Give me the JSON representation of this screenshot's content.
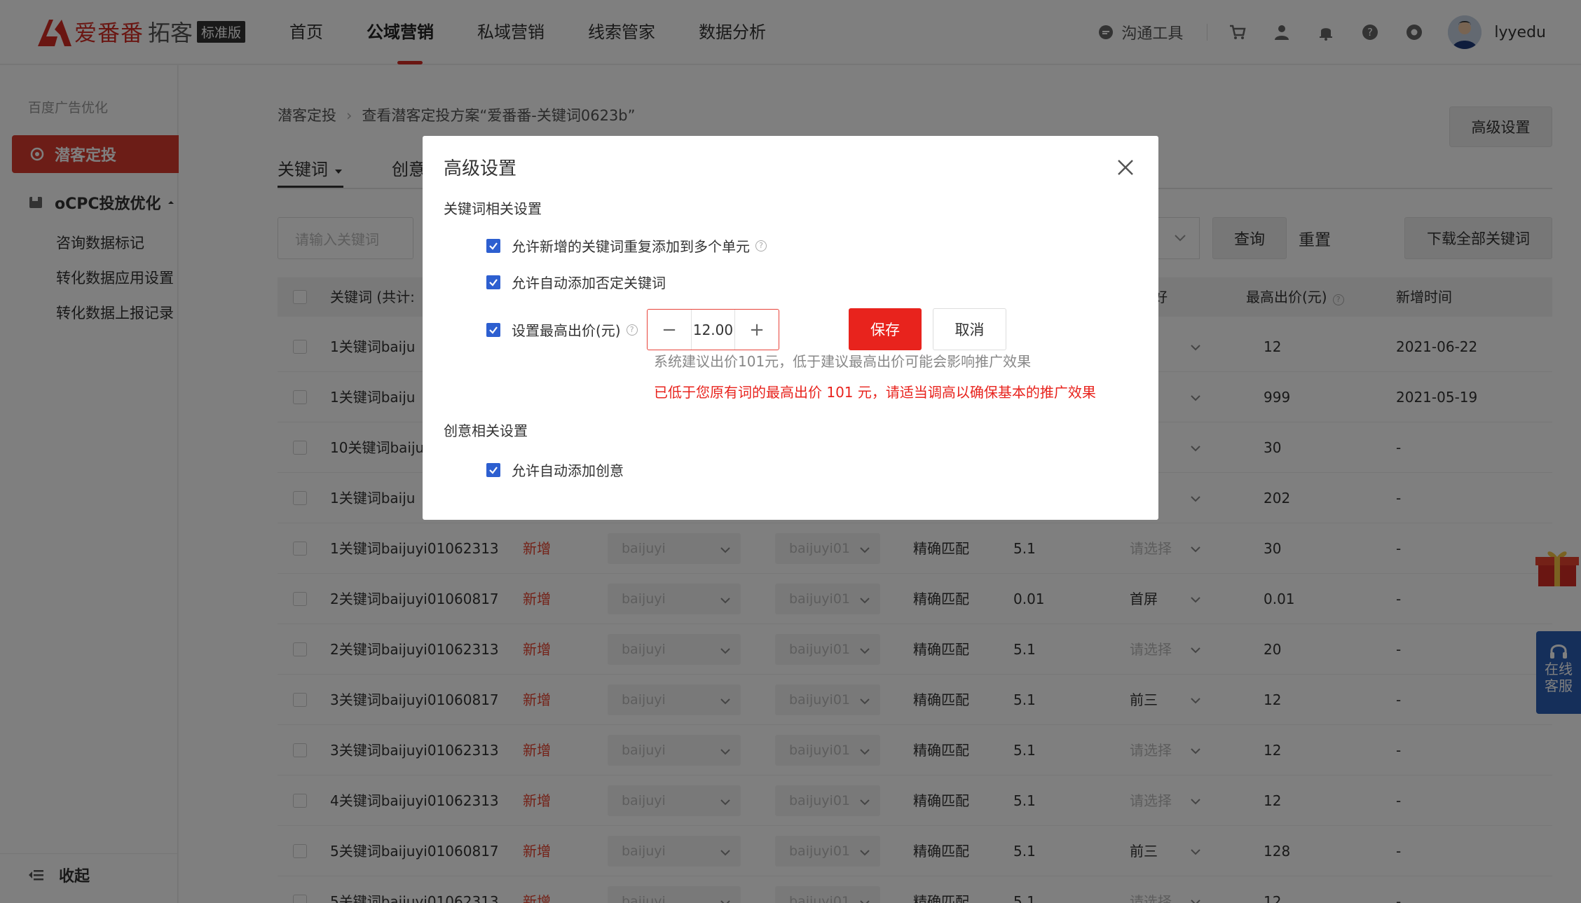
{
  "brand": {
    "name": "爱番番",
    "product": "拓客",
    "edition": "标准版"
  },
  "nav": {
    "items": [
      {
        "label": "首页"
      },
      {
        "label": "公域营销"
      },
      {
        "label": "私域营销"
      },
      {
        "label": "线索管家"
      },
      {
        "label": "数据分析"
      }
    ]
  },
  "tools": {
    "comm_label": "沟通工具",
    "username": "lyyedu"
  },
  "sidebar": {
    "section_title": "百度广告优化",
    "active_item": "潜客定投",
    "group_label": "oCPC投放优化",
    "sub_items": [
      {
        "label": "咨询数据标记"
      },
      {
        "label": "转化数据应用设置"
      },
      {
        "label": "转化数据上报记录"
      }
    ],
    "collapse_label": "收起"
  },
  "main": {
    "breadcrumb": {
      "root": "潜客定投",
      "current": "查看潜客定投方案“爱番番-关键词0623b”"
    },
    "advanced_button": "高级设置",
    "tabs": [
      {
        "label": "关键词"
      },
      {
        "label": "创意"
      }
    ],
    "filter": {
      "keyword_placeholder": "请输入关键词",
      "query": "查询",
      "reset": "重置",
      "download": "下载全部关键词"
    },
    "table": {
      "headers": {
        "keyword": "关键词 (共计:",
        "pref": "好",
        "max_bid": "最高出价(元)",
        "added_time": "新增时间"
      },
      "rows": [
        {
          "kw": "1关键词baiju",
          "status": "",
          "plan": "",
          "unit": "",
          "match": "",
          "bid": "",
          "pref": "择",
          "max_bid": "12",
          "time": "2021-06-22",
          "dim": true
        },
        {
          "kw": "1关键词baiju",
          "status": "",
          "plan": "",
          "unit": "",
          "match": "",
          "bid": "",
          "pref": "",
          "max_bid": "999",
          "time": "2021-05-19",
          "dim": true
        },
        {
          "kw": "10关键词baiju",
          "status": "",
          "plan": "",
          "unit": "",
          "match": "",
          "bid": "",
          "pref": "择",
          "max_bid": "30",
          "time": "-",
          "dim": true
        },
        {
          "kw": "1关键词baiju",
          "status": "",
          "plan": "",
          "unit": "",
          "match": "",
          "bid": "",
          "pref": "",
          "max_bid": "202",
          "time": "-",
          "dim": true
        },
        {
          "kw": "1关键词baijuyi01062313",
          "status": "新增",
          "plan": "baijuyi",
          "unit": "baijuyi01",
          "match": "精确匹配",
          "bid": "5.1",
          "pref": "请选择",
          "max_bid": "30",
          "time": "-",
          "dim": true
        },
        {
          "kw": "2关键词baijuyi01060817",
          "status": "新增",
          "plan": "baijuyi",
          "unit": "baijuyi01",
          "match": "精确匹配",
          "bid": "0.01",
          "pref": "首屏",
          "max_bid": "0.01",
          "time": "-",
          "dim": false
        },
        {
          "kw": "2关键词baijuyi01062313",
          "status": "新增",
          "plan": "baijuyi",
          "unit": "baijuyi01",
          "match": "精确匹配",
          "bid": "5.1",
          "pref": "请选择",
          "max_bid": "20",
          "time": "-",
          "dim": true
        },
        {
          "kw": "3关键词baijuyi01060817",
          "status": "新增",
          "plan": "baijuyi",
          "unit": "baijuyi01",
          "match": "精确匹配",
          "bid": "5.1",
          "pref": "前三",
          "max_bid": "12",
          "time": "-",
          "dim": false
        },
        {
          "kw": "3关键词baijuyi01062313",
          "status": "新增",
          "plan": "baijuyi",
          "unit": "baijuyi01",
          "match": "精确匹配",
          "bid": "5.1",
          "pref": "请选择",
          "max_bid": "12",
          "time": "-",
          "dim": true
        },
        {
          "kw": "4关键词baijuyi01062313",
          "status": "新增",
          "plan": "baijuyi",
          "unit": "baijuyi01",
          "match": "精确匹配",
          "bid": "5.1",
          "pref": "请选择",
          "max_bid": "12",
          "time": "-",
          "dim": true
        },
        {
          "kw": "5关键词baijuyi01060817",
          "status": "新增",
          "plan": "baijuyi",
          "unit": "baijuyi01",
          "match": "精确匹配",
          "bid": "5.1",
          "pref": "前三",
          "max_bid": "128",
          "time": "-",
          "dim": false
        },
        {
          "kw": "5关键词baijuyi01062313",
          "status": "新增",
          "plan": "baijuyi",
          "unit": "baijuyi01",
          "match": "精确匹配",
          "bid": "5.1",
          "pref": "请选择",
          "max_bid": "12",
          "time": "-",
          "dim": true
        }
      ]
    }
  },
  "modal": {
    "title": "高级设置",
    "section_keyword": "关键词相关设置",
    "opt_dup": "允许新增的关键词重复添加到多个单元",
    "opt_negative": "允许自动添加否定关键词",
    "opt_maxbid": "设置最高出价(元)",
    "bid_value": "12.00",
    "save": "保存",
    "cancel": "取消",
    "hint": "系统建议出价101元，低于建议最高出价可能会影响推广效果",
    "warning": "已低于您原有词的最高出价 101 元，请适当调高以确保基本的推广效果",
    "section_creative": "创意相关设置",
    "opt_creative": "允许自动添加创意"
  },
  "float": {
    "service_line1": "在线",
    "service_line2": "客服"
  },
  "colors": {
    "brand_red": "#d42d24",
    "primary_blue": "#2d5fd0",
    "danger": "#e8231d",
    "service_blue": "#2b5fb5"
  }
}
